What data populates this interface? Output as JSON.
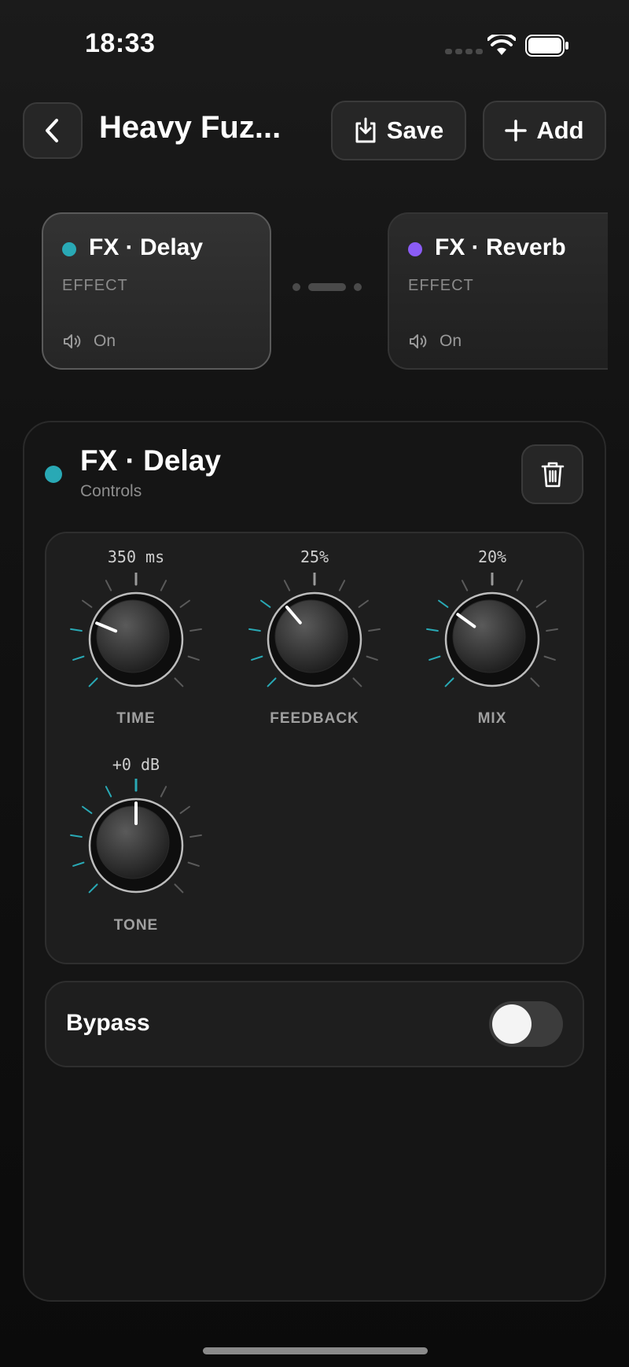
{
  "status_bar": {
    "time": "18:33"
  },
  "header": {
    "title": "Heavy Fuz...",
    "save_label": "Save",
    "add_label": "Add"
  },
  "chain": {
    "cards": [
      {
        "title": "FX · Delay",
        "subtitle": "EFFECT",
        "status": "On",
        "dot_color": "#29a9b5",
        "selected": true
      },
      {
        "title": "FX · Reverb",
        "subtitle": "EFFECT",
        "status": "On",
        "dot_color": "#8b5cf6",
        "selected": false
      }
    ]
  },
  "panel": {
    "title": "FX · Delay",
    "subtitle": "Controls",
    "dot_color": "#29a9b5",
    "knobs": [
      {
        "label": "TIME",
        "value": "350 ms",
        "level": 0.25
      },
      {
        "label": "FEEDBACK",
        "value": "25%",
        "level": 0.35
      },
      {
        "label": "MIX",
        "value": "20%",
        "level": 0.3
      },
      {
        "label": "TONE",
        "value": "+0 dB",
        "level": 0.5
      }
    ],
    "bypass": {
      "label": "Bypass",
      "on": false
    }
  },
  "colors": {
    "accent": "#29a9b5",
    "reverb": "#8b5cf6",
    "background": "#121212"
  }
}
